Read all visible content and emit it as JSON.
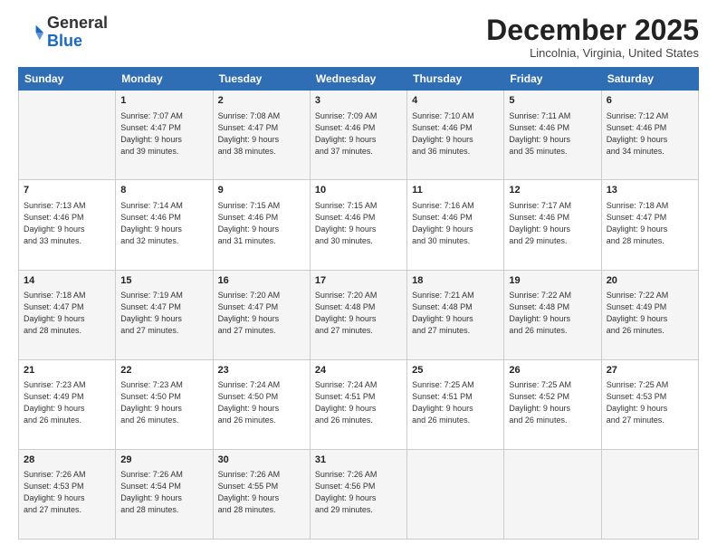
{
  "logo": {
    "general": "General",
    "blue": "Blue"
  },
  "header": {
    "title": "December 2025",
    "location": "Lincolnia, Virginia, United States"
  },
  "weekdays": [
    "Sunday",
    "Monday",
    "Tuesday",
    "Wednesday",
    "Thursday",
    "Friday",
    "Saturday"
  ],
  "weeks": [
    [
      {
        "day": "",
        "info": ""
      },
      {
        "day": "1",
        "info": "Sunrise: 7:07 AM\nSunset: 4:47 PM\nDaylight: 9 hours\nand 39 minutes."
      },
      {
        "day": "2",
        "info": "Sunrise: 7:08 AM\nSunset: 4:47 PM\nDaylight: 9 hours\nand 38 minutes."
      },
      {
        "day": "3",
        "info": "Sunrise: 7:09 AM\nSunset: 4:46 PM\nDaylight: 9 hours\nand 37 minutes."
      },
      {
        "day": "4",
        "info": "Sunrise: 7:10 AM\nSunset: 4:46 PM\nDaylight: 9 hours\nand 36 minutes."
      },
      {
        "day": "5",
        "info": "Sunrise: 7:11 AM\nSunset: 4:46 PM\nDaylight: 9 hours\nand 35 minutes."
      },
      {
        "day": "6",
        "info": "Sunrise: 7:12 AM\nSunset: 4:46 PM\nDaylight: 9 hours\nand 34 minutes."
      }
    ],
    [
      {
        "day": "7",
        "info": "Sunrise: 7:13 AM\nSunset: 4:46 PM\nDaylight: 9 hours\nand 33 minutes."
      },
      {
        "day": "8",
        "info": "Sunrise: 7:14 AM\nSunset: 4:46 PM\nDaylight: 9 hours\nand 32 minutes."
      },
      {
        "day": "9",
        "info": "Sunrise: 7:15 AM\nSunset: 4:46 PM\nDaylight: 9 hours\nand 31 minutes."
      },
      {
        "day": "10",
        "info": "Sunrise: 7:15 AM\nSunset: 4:46 PM\nDaylight: 9 hours\nand 30 minutes."
      },
      {
        "day": "11",
        "info": "Sunrise: 7:16 AM\nSunset: 4:46 PM\nDaylight: 9 hours\nand 30 minutes."
      },
      {
        "day": "12",
        "info": "Sunrise: 7:17 AM\nSunset: 4:46 PM\nDaylight: 9 hours\nand 29 minutes."
      },
      {
        "day": "13",
        "info": "Sunrise: 7:18 AM\nSunset: 4:47 PM\nDaylight: 9 hours\nand 28 minutes."
      }
    ],
    [
      {
        "day": "14",
        "info": "Sunrise: 7:18 AM\nSunset: 4:47 PM\nDaylight: 9 hours\nand 28 minutes."
      },
      {
        "day": "15",
        "info": "Sunrise: 7:19 AM\nSunset: 4:47 PM\nDaylight: 9 hours\nand 27 minutes."
      },
      {
        "day": "16",
        "info": "Sunrise: 7:20 AM\nSunset: 4:47 PM\nDaylight: 9 hours\nand 27 minutes."
      },
      {
        "day": "17",
        "info": "Sunrise: 7:20 AM\nSunset: 4:48 PM\nDaylight: 9 hours\nand 27 minutes."
      },
      {
        "day": "18",
        "info": "Sunrise: 7:21 AM\nSunset: 4:48 PM\nDaylight: 9 hours\nand 27 minutes."
      },
      {
        "day": "19",
        "info": "Sunrise: 7:22 AM\nSunset: 4:48 PM\nDaylight: 9 hours\nand 26 minutes."
      },
      {
        "day": "20",
        "info": "Sunrise: 7:22 AM\nSunset: 4:49 PM\nDaylight: 9 hours\nand 26 minutes."
      }
    ],
    [
      {
        "day": "21",
        "info": "Sunrise: 7:23 AM\nSunset: 4:49 PM\nDaylight: 9 hours\nand 26 minutes."
      },
      {
        "day": "22",
        "info": "Sunrise: 7:23 AM\nSunset: 4:50 PM\nDaylight: 9 hours\nand 26 minutes."
      },
      {
        "day": "23",
        "info": "Sunrise: 7:24 AM\nSunset: 4:50 PM\nDaylight: 9 hours\nand 26 minutes."
      },
      {
        "day": "24",
        "info": "Sunrise: 7:24 AM\nSunset: 4:51 PM\nDaylight: 9 hours\nand 26 minutes."
      },
      {
        "day": "25",
        "info": "Sunrise: 7:25 AM\nSunset: 4:51 PM\nDaylight: 9 hours\nand 26 minutes."
      },
      {
        "day": "26",
        "info": "Sunrise: 7:25 AM\nSunset: 4:52 PM\nDaylight: 9 hours\nand 26 minutes."
      },
      {
        "day": "27",
        "info": "Sunrise: 7:25 AM\nSunset: 4:53 PM\nDaylight: 9 hours\nand 27 minutes."
      }
    ],
    [
      {
        "day": "28",
        "info": "Sunrise: 7:26 AM\nSunset: 4:53 PM\nDaylight: 9 hours\nand 27 minutes."
      },
      {
        "day": "29",
        "info": "Sunrise: 7:26 AM\nSunset: 4:54 PM\nDaylight: 9 hours\nand 28 minutes."
      },
      {
        "day": "30",
        "info": "Sunrise: 7:26 AM\nSunset: 4:55 PM\nDaylight: 9 hours\nand 28 minutes."
      },
      {
        "day": "31",
        "info": "Sunrise: 7:26 AM\nSunset: 4:56 PM\nDaylight: 9 hours\nand 29 minutes."
      },
      {
        "day": "",
        "info": ""
      },
      {
        "day": "",
        "info": ""
      },
      {
        "day": "",
        "info": ""
      }
    ]
  ]
}
